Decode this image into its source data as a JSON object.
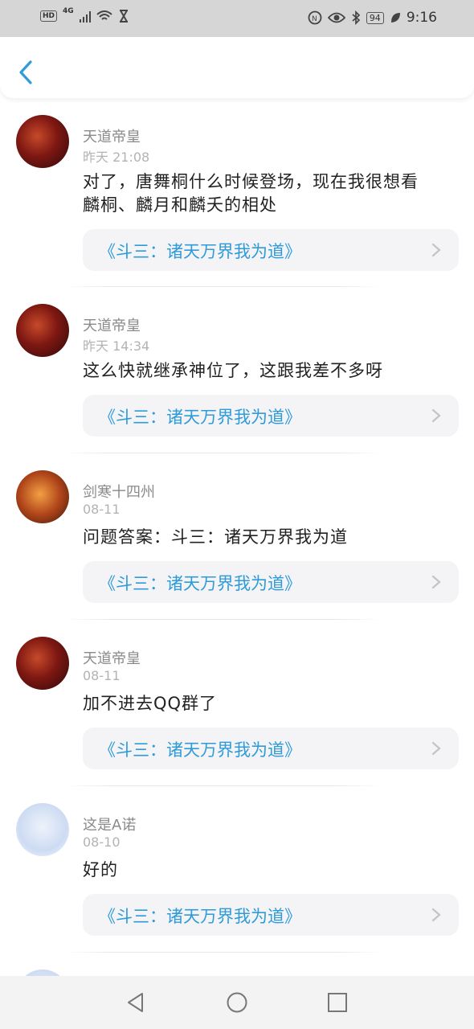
{
  "status_bar": {
    "left_icons": [
      "hd-icon",
      "4g-signal-icon",
      "wifi-icon",
      "hourglass-icon"
    ],
    "hd": "HD",
    "network": "4G",
    "battery": "94",
    "time": "9:16",
    "right_icons": [
      "nfc-icon",
      "eye-icon",
      "bluetooth-icon",
      "battery-icon",
      "leaf-icon"
    ]
  },
  "header": {
    "back_icon": "chevron-left-icon",
    "accent": "#2f9bd8"
  },
  "comments": [
    {
      "author": "天道帝皇",
      "time": "昨天 21:08",
      "text_lines": [
        "对了，唐舞桐什么时候登场，现在我很想看",
        "麟桐、麟月和麟夭的相处"
      ],
      "book": "《斗三：诸天万界我为道》"
    },
    {
      "author": "天道帝皇",
      "time": "昨天 14:34",
      "text_lines": [
        "这么快就继承神位了，这跟我差不多呀"
      ],
      "book": "《斗三：诸天万界我为道》"
    },
    {
      "author": "剑寒十四州",
      "time": "08-11",
      "text_lines": [
        "问题答案：斗三：诸天万界我为道"
      ],
      "book": "《斗三：诸天万界我为道》"
    },
    {
      "author": "天道帝皇",
      "time": "08-11",
      "text_lines": [
        "加不进去QQ群了"
      ],
      "book": "《斗三：诸天万界我为道》"
    },
    {
      "author": "这是A诺",
      "time": "08-10",
      "text_lines": [
        "好的"
      ],
      "book": "《斗三：诸天万界我为道》"
    }
  ],
  "nav_bar": {
    "buttons": [
      "back-triangle-icon",
      "home-circle-icon",
      "recents-square-icon"
    ]
  }
}
